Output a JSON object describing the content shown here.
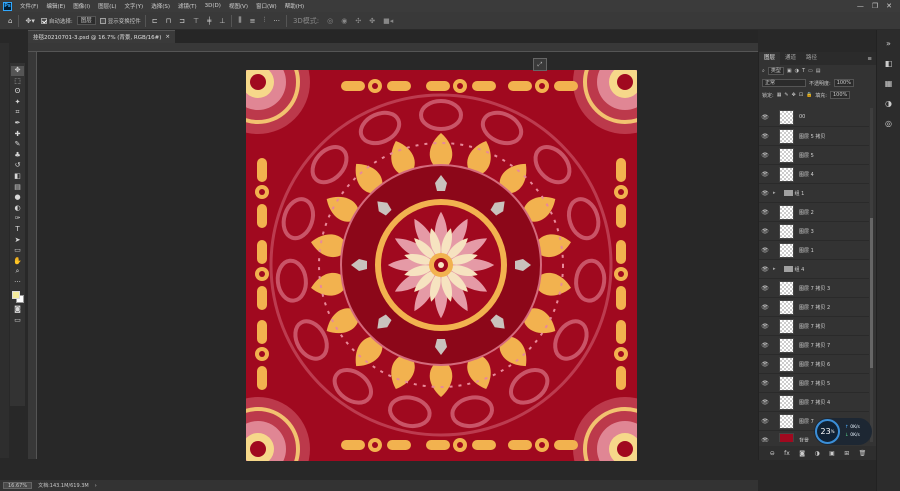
{
  "menubar": {
    "logo": "Ps",
    "items": [
      "文件(F)",
      "编辑(E)",
      "图像(I)",
      "图层(L)",
      "文字(Y)",
      "选择(S)",
      "滤镜(T)",
      "3D(D)",
      "视图(V)",
      "窗口(W)",
      "帮助(H)"
    ],
    "window_controls": [
      "—",
      "❐",
      "✕"
    ]
  },
  "optionsbar": {
    "auto_select_label": "自动选择:",
    "auto_select_checked": true,
    "auto_select_target": "图层",
    "show_transform_label": "显示变换控件",
    "show_transform_checked": false
  },
  "document": {
    "tab_title": "挂毯20210701-3.psd @ 16.7% (背景, RGB/16#)",
    "tab_close": "×",
    "background_color": "#a0091f"
  },
  "colors": {
    "foreground": "#f5ec9d",
    "background": "#ffffff",
    "artboard": "#a0091f",
    "accent": "#31a8ff"
  },
  "toolbar": {
    "tools": [
      "move-tool",
      "marquee-tool",
      "lasso-tool",
      "magic-wand-tool",
      "crop-tool",
      "eyedropper-tool",
      "healing-brush-tool",
      "brush-tool",
      "clone-stamp-tool",
      "history-brush-tool",
      "eraser-tool",
      "gradient-tool",
      "blur-tool",
      "dodge-tool",
      "pen-tool",
      "type-tool",
      "path-selection-tool",
      "rectangle-tool",
      "hand-tool",
      "zoom-tool",
      "more-tools-icon"
    ],
    "glyphs": [
      "✥",
      "⬚",
      "ʘ",
      "✦",
      "⌗",
      "✒",
      "✚",
      "✎",
      "♣",
      "↺",
      "◧",
      "▤",
      "●",
      "◐",
      "✑",
      "T",
      "➤",
      "▭",
      "✋",
      "⌕",
      "···"
    ]
  },
  "statusbar": {
    "zoom": "16.67%",
    "doc_info": "文档:143.1M/619.3M",
    "arrow": "›"
  },
  "layers_panel": {
    "tabs": [
      "图层",
      "通道",
      "路径"
    ],
    "filter_label": "类型",
    "blend_mode": "正常",
    "opacity_label": "不透明度:",
    "opacity_value": "100%",
    "lock_label": "锁定:",
    "fill_label": "填充:",
    "fill_value": "100%",
    "layers": [
      {
        "name": "00",
        "kind": "layer"
      },
      {
        "name": "图层 5 拷贝",
        "kind": "layer"
      },
      {
        "name": "图层 5",
        "kind": "layer"
      },
      {
        "name": "图层 4",
        "kind": "layer"
      },
      {
        "name": "组 1",
        "kind": "group"
      },
      {
        "name": "图层 2",
        "kind": "layer"
      },
      {
        "name": "图层 3",
        "kind": "layer"
      },
      {
        "name": "图层 1",
        "kind": "layer"
      },
      {
        "name": "组 4",
        "kind": "group"
      },
      {
        "name": "图层 7 拷贝 3",
        "kind": "layer"
      },
      {
        "name": "图层 7 拷贝 2",
        "kind": "layer"
      },
      {
        "name": "图层 7 拷贝",
        "kind": "layer"
      },
      {
        "name": "图层 7 拷贝 7",
        "kind": "layer"
      },
      {
        "name": "图层 7 拷贝 6",
        "kind": "layer"
      },
      {
        "name": "图层 7 拷贝 5",
        "kind": "layer"
      },
      {
        "name": "图层 7 拷贝 4",
        "kind": "layer"
      },
      {
        "name": "图层 7",
        "kind": "layer"
      },
      {
        "name": "背景",
        "kind": "background"
      }
    ],
    "bottom_icons": [
      "⊖",
      "fx",
      "◙",
      "◑",
      "▣",
      "⊞",
      "🗑"
    ]
  },
  "network_widget": {
    "percent": "23",
    "percent_unit": "%",
    "up": "0K/s",
    "down": "0K/s",
    "up_arrow": "↑",
    "down_arrow": "↓"
  }
}
